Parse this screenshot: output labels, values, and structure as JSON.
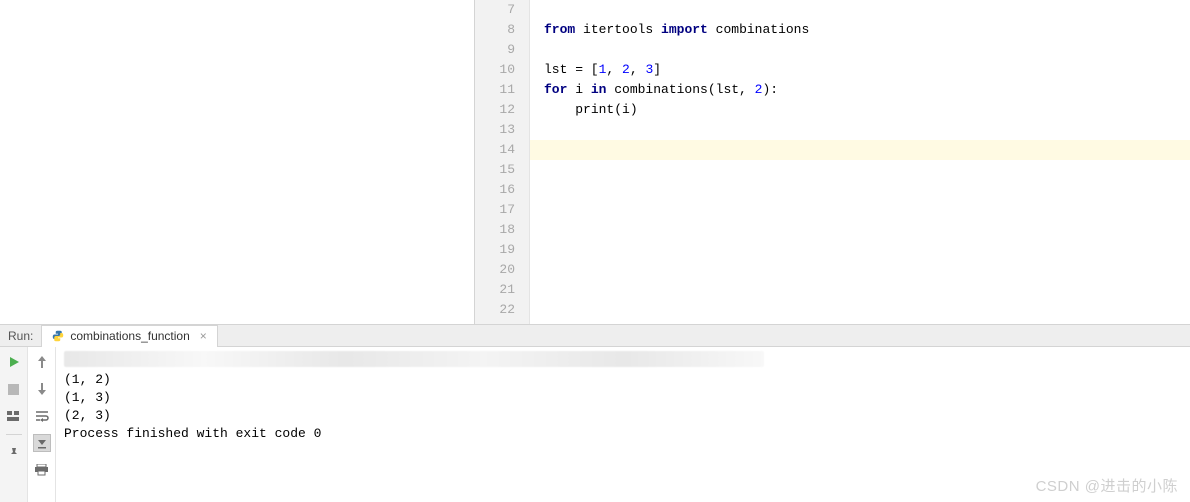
{
  "editor": {
    "line_numbers": [
      "7",
      "8",
      "9",
      "10",
      "11",
      "12",
      "13",
      "14",
      "15",
      "16",
      "17",
      "18",
      "19",
      "20",
      "21",
      "22"
    ],
    "lines": {
      "l7": "",
      "l8_kw1": "from",
      "l8_mod": " itertools ",
      "l8_kw2": "import",
      "l8_func": " combinations",
      "l9": "",
      "l10_pre": "lst = [",
      "l10_n1": "1",
      "l10_c1": ", ",
      "l10_n2": "2",
      "l10_c2": ", ",
      "l10_n3": "3",
      "l10_post": "]",
      "l11_kw1": "for",
      "l11_mid1": " i ",
      "l11_kw2": "in",
      "l11_mid2": " combinations(lst, ",
      "l11_n": "2",
      "l11_post": "):",
      "l12_indent": "    ",
      "l12_fn": "print",
      "l12_post": "(i)",
      "l13": "",
      "l14": "",
      "l15": "",
      "l16": "",
      "l17": "",
      "l18": "",
      "l19": "",
      "l20": "",
      "l21": "",
      "l22": ""
    },
    "highlighted_line": 14
  },
  "run": {
    "label": "Run:",
    "tab_name": "combinations_function",
    "output": {
      "r1": "(1, 2)",
      "r2": "(1, 3)",
      "r3": "(2, 3)",
      "blank": "",
      "exit": "Process finished with exit code 0"
    }
  },
  "watermark": "CSDN @进击的小陈",
  "icons": {
    "run": "run-icon",
    "stop": "stop-icon",
    "layout": "layout-icon",
    "divider": "divider-icon",
    "pin": "pin-icon",
    "up": "up-arrow-icon",
    "down": "down-arrow-icon",
    "softwrap": "softwrap-icon",
    "scroll_end": "scroll-end-icon",
    "print": "print-icon"
  }
}
